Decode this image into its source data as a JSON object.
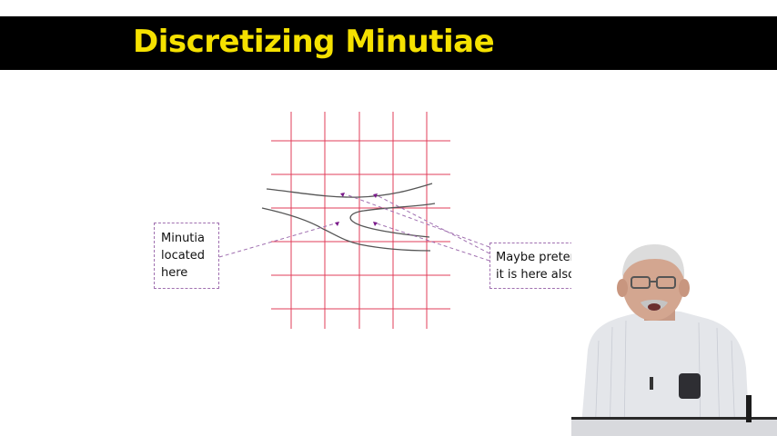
{
  "slide": {
    "title": "Discretizing Minutiae",
    "title_color": "#f5e100",
    "grid_color": "#e23c5a",
    "ridge_color": "#555555",
    "dashed_line_color": "#a070b0",
    "marker_color": "#7a1a8a"
  },
  "callouts": {
    "left": {
      "lines": [
        "Minutia",
        "located",
        "here"
      ]
    },
    "right": {
      "lines": [
        "Maybe pretend",
        "it is here also"
      ]
    }
  },
  "presenter": {
    "icon": "presenter-video-inset"
  }
}
